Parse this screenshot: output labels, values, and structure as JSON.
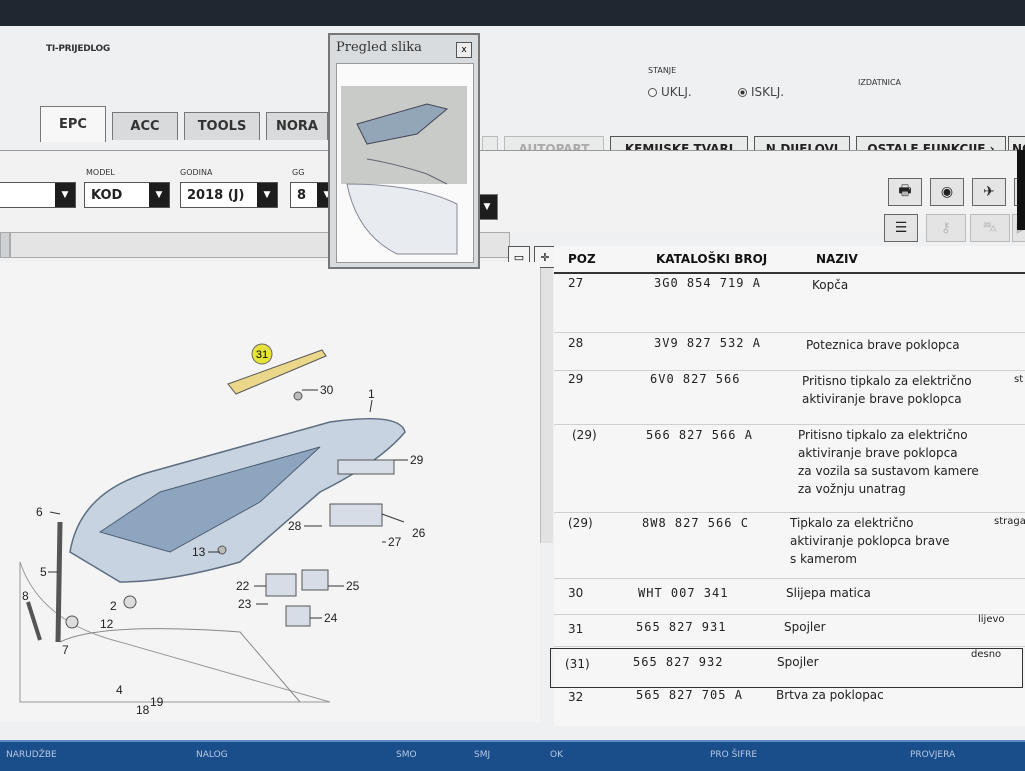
{
  "app": {
    "title": "TI-PRIJEDLOG",
    "stanje_label": "STANJE",
    "stanje_options": [
      "UKLJ.",
      "ISKLJ."
    ],
    "stanje_selected": "ISKLJ.",
    "izdatnica_label": "IZDATNICA"
  },
  "tabs": [
    "EPC",
    "ACC",
    "TOOLS",
    "NORA"
  ],
  "active_tab": "EPC",
  "tabs_right": [
    "AUTOPART",
    "KEMIJSKE TVARI",
    "N.DIJELOVI",
    "OSTALE FUNKCIJE ›",
    "NO"
  ],
  "filters": {
    "model_label": "MODEL",
    "model_value": "KOD",
    "godina_label": "GODINA",
    "godina_value": "2018 (J)",
    "gg_label": "GG",
    "gg_value": "8"
  },
  "preview": {
    "title": "Pregled slika",
    "close": "x"
  },
  "grid": {
    "headers": [
      "POZ",
      "KATALOŠKI BROJ",
      "NAZIV"
    ],
    "rows": [
      {
        "poz": "27",
        "kat": "3G0 854 719 A",
        "naziv": "Kopča",
        "napomena": ""
      },
      {
        "poz": "28",
        "kat": "3V9 827 532 A",
        "naziv": "Poteznica brave poklopca",
        "napomena": ""
      },
      {
        "poz": "29",
        "kat": "6V0 827 566",
        "naziv": "Pritisno tipkalo za električno\naktiviranje brave poklopca",
        "napomena": "st"
      },
      {
        "poz": "(29)",
        "kat": "566 827 566 A",
        "naziv": "Pritisno tipkalo za električno\naktiviranje brave poklopca\nza vozila sa sustavom kamere\nza vožnju unatrag",
        "napomena": ""
      },
      {
        "poz": "(29)",
        "kat": "8W8 827 566 C",
        "naziv": "Tipkalo za električno\naktiviranje poklopca brave\ns kamerom",
        "napomena": "straga"
      },
      {
        "poz": "30",
        "kat": "WHT 007 341",
        "naziv": "Slijepa matica",
        "napomena": ""
      },
      {
        "poz": "31",
        "kat": "565 827 931",
        "naziv": "Spojler",
        "napomena": "lijevo"
      },
      {
        "poz": "(31)",
        "kat": "565 827 932",
        "naziv": "Spojler",
        "napomena": "desno"
      },
      {
        "poz": "32",
        "kat": "565 827 705 A",
        "naziv": "Brtva za poklopac",
        "napomena": ""
      }
    ]
  },
  "diagram": {
    "callouts": [
      "31",
      "30",
      "1",
      "29",
      "6",
      "28",
      "26",
      "27",
      "13",
      "5",
      "22",
      "25",
      "23",
      "24",
      "8",
      "2",
      "12",
      "7",
      "4",
      "19",
      "18"
    ],
    "highlighted": "31"
  },
  "statusbar": [
    "NARUDŽBE",
    "NALOG",
    "SMO",
    "SMJ",
    "OK",
    "PRO ŠIFRE",
    "PROVJERA"
  ]
}
